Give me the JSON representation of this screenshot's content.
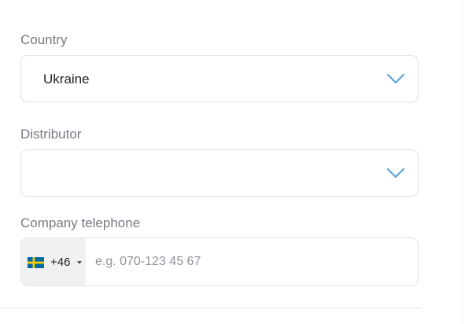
{
  "form": {
    "country": {
      "label": "Country",
      "value": "Ukraine",
      "icon": "chevron-down-icon"
    },
    "distributor": {
      "label": "Distributor",
      "value": "",
      "icon": "chevron-down-icon"
    },
    "company_telephone": {
      "label": "Company telephone",
      "country_flag": "sweden-flag-icon",
      "dial_code": "+46",
      "value": "",
      "placeholder": "e.g. 070-123 45 67"
    }
  },
  "colors": {
    "label": "#777a85",
    "chevron": "#5aa6d6",
    "border": "#e2e3e8",
    "flag_blue": "#006aa7",
    "flag_yellow": "#fecc00"
  }
}
